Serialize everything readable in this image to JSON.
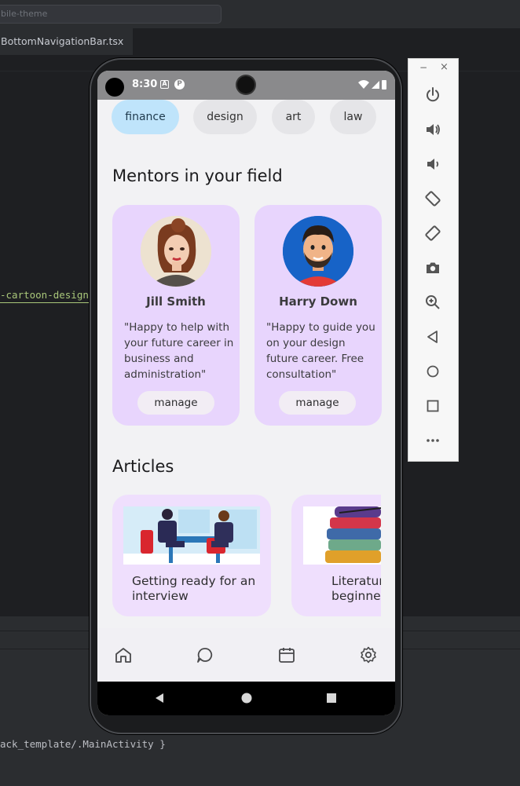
{
  "ide": {
    "search_placeholder": "bile-theme",
    "tab_label": "BottomNavigationBar.tsx",
    "code_snippet": "-cartoon-design",
    "activity_text": "ack_template/.MainActivity }"
  },
  "status_bar": {
    "time": "8:30",
    "icon_a": "A",
    "icon_p": "P"
  },
  "categories": [
    {
      "label": "finance",
      "active": true
    },
    {
      "label": "design",
      "active": false
    },
    {
      "label": "art",
      "active": false
    },
    {
      "label": "law",
      "active": false
    }
  ],
  "mentors_section": {
    "title": "Mentors in your field",
    "mentors": [
      {
        "name": "Jill Smith",
        "quote": "\"Happy to help with your future career in business and administration\"",
        "button": "manage"
      },
      {
        "name": "Harry Down",
        "quote": "\"Happy to guide you on your design future career. Free consultation\"",
        "button": "manage"
      }
    ]
  },
  "articles_section": {
    "title": "Articles",
    "articles": [
      {
        "title": "Getting ready for an interview"
      },
      {
        "title": "Literatur beginner"
      }
    ]
  },
  "bottom_nav": {
    "items": [
      "home-icon",
      "chat-icon",
      "calendar-icon",
      "settings-icon"
    ]
  },
  "emulator_toolbar": {
    "minimize": "−",
    "close": "×",
    "buttons": [
      "power-icon",
      "volume-up-icon",
      "volume-down-icon",
      "rotate-left-icon",
      "rotate-right-icon",
      "camera-icon",
      "zoom-icon",
      "back-icon",
      "home-circle-icon",
      "overview-icon",
      "more-icon"
    ]
  },
  "colors": {
    "chip_active": "#bfe4fb",
    "mentor_card": "#e8d5fd",
    "article_card": "#efdffd"
  }
}
